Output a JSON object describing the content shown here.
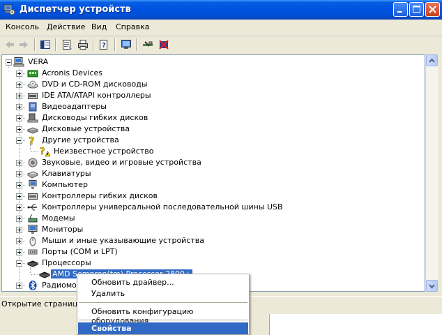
{
  "window": {
    "title": "Диспетчер устройств"
  },
  "menu": [
    "Консоль",
    "Действие",
    "Вид",
    "Справка"
  ],
  "toolbar": {
    "icons": [
      "back-icon",
      "forward-icon",
      "tree-toggle-icon",
      "properties-icon",
      "print-icon",
      "help-icon",
      "scan-hardware-icon",
      "update-driver-icon",
      "uninstall-icon"
    ]
  },
  "tree": {
    "root": "VERA",
    "items": [
      {
        "label": "Acronis Devices",
        "icon": "acronis-icon",
        "expander": "plus"
      },
      {
        "label": "DVD и CD-ROM дисководы",
        "icon": "cdrom-icon",
        "expander": "plus"
      },
      {
        "label": "IDE ATA/ATAPI контроллеры",
        "icon": "ide-controller-icon",
        "expander": "plus"
      },
      {
        "label": "Видеоадаптеры",
        "icon": "display-adapter-icon",
        "expander": "plus"
      },
      {
        "label": "Дисководы гибких дисков",
        "icon": "floppy-drive-icon",
        "expander": "plus"
      },
      {
        "label": "Дисковые устройства",
        "icon": "disk-drive-icon",
        "expander": "plus"
      },
      {
        "label": "Другие устройства",
        "icon": "unknown-device-icon",
        "expander": "minus"
      },
      {
        "label": "Неизвестное устройство",
        "icon": "unknown-device-warning-icon",
        "expander": "none",
        "child": true
      },
      {
        "label": "Звуковые, видео и игровые устройства",
        "icon": "sound-icon",
        "expander": "plus"
      },
      {
        "label": "Клавиатуры",
        "icon": "keyboard-icon",
        "expander": "plus"
      },
      {
        "label": "Компьютер",
        "icon": "computer-icon",
        "expander": "plus"
      },
      {
        "label": "Контроллеры гибких дисков",
        "icon": "floppy-controller-icon",
        "expander": "plus"
      },
      {
        "label": "Контроллеры универсальной последовательной шины USB",
        "icon": "usb-icon",
        "expander": "plus"
      },
      {
        "label": "Модемы",
        "icon": "modem-icon",
        "expander": "plus"
      },
      {
        "label": "Мониторы",
        "icon": "monitor-icon",
        "expander": "plus"
      },
      {
        "label": "Мыши и иные указывающие устройства",
        "icon": "mouse-icon",
        "expander": "plus"
      },
      {
        "label": "Порты (COM и LPT)",
        "icon": "port-icon",
        "expander": "plus"
      },
      {
        "label": "Процессоры",
        "icon": "processor-icon",
        "expander": "minus"
      },
      {
        "label": "AMD Sempron(tm) Processor 2800+",
        "icon": "cpu-chip-icon",
        "expander": "none",
        "child": true,
        "selected": true
      },
      {
        "label": "Радиомодули Bluetooth",
        "icon": "bluetooth-icon",
        "expander": "plus"
      }
    ]
  },
  "status": {
    "text": "Открытие страницы свойств для текущего выделения."
  },
  "context_menu": {
    "items": [
      {
        "label": "Обновить драйвер..."
      },
      {
        "label": "Удалить"
      },
      {
        "label": "Обновить конфигурацию оборудования"
      },
      {
        "label": "Свойства",
        "highlighted": true
      }
    ]
  },
  "colors": {
    "titlebar": "#0054e3",
    "selection": "#316ac5"
  }
}
